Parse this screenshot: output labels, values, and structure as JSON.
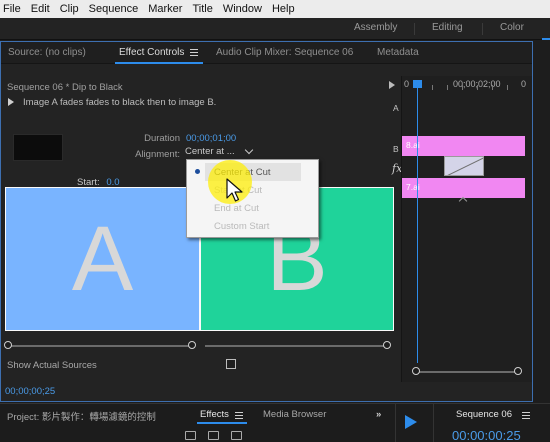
{
  "menubar": {
    "items": [
      "File",
      "Edit",
      "Clip",
      "Sequence",
      "Marker",
      "Title",
      "Window",
      "Help"
    ]
  },
  "workspaces": [
    "Assembly",
    "Editing",
    "Color"
  ],
  "panel_tabs": {
    "source": "Source: (no clips)",
    "effect_controls": "Effect Controls",
    "audio_mixer": "Audio Clip Mixer: Sequence 06",
    "metadata": "Metadata"
  },
  "effect_controls": {
    "sequence_label": "Sequence 06 * Dip to Black",
    "description": "Image A fades fades to black then to image B.",
    "duration_label": "Duration",
    "duration_value": "00;00;01;00",
    "alignment_label": "Alignment:",
    "alignment_value": "Center at ...",
    "start_label": "Start:",
    "start_value": "0.0",
    "preview_a": "A",
    "preview_b": "B",
    "show_actual_sources": "Show Actual Sources",
    "timecode": "00;00;00;25"
  },
  "alignment_menu": {
    "options": [
      "Center at Cut",
      "Start at Cut",
      "End at Cut",
      "Custom Start"
    ],
    "selected": "Center at Cut"
  },
  "mini_timeline": {
    "start_label": "0",
    "time_label": "00;00;02;00",
    "end_label": "0",
    "track_a": "A",
    "track_b": "B",
    "clip_a": "8.ai",
    "clip_b": "7.ai",
    "fx_label": "fx"
  },
  "bottom": {
    "project_tab": "Project: 影片製作：轉場濾鏡的控制",
    "effects_tab": "Effects",
    "media_browser_tab": "Media Browser",
    "sequence_tab": "Sequence 06",
    "timecode": "00:00:00:25"
  },
  "colors": {
    "accent": "#2d8ceb",
    "timecode_blue": "#4a9be8",
    "panel_a": "#79b4ff",
    "panel_b": "#1fd39a",
    "clip_pink": "#f187f2",
    "highlight": "#ffee00"
  }
}
